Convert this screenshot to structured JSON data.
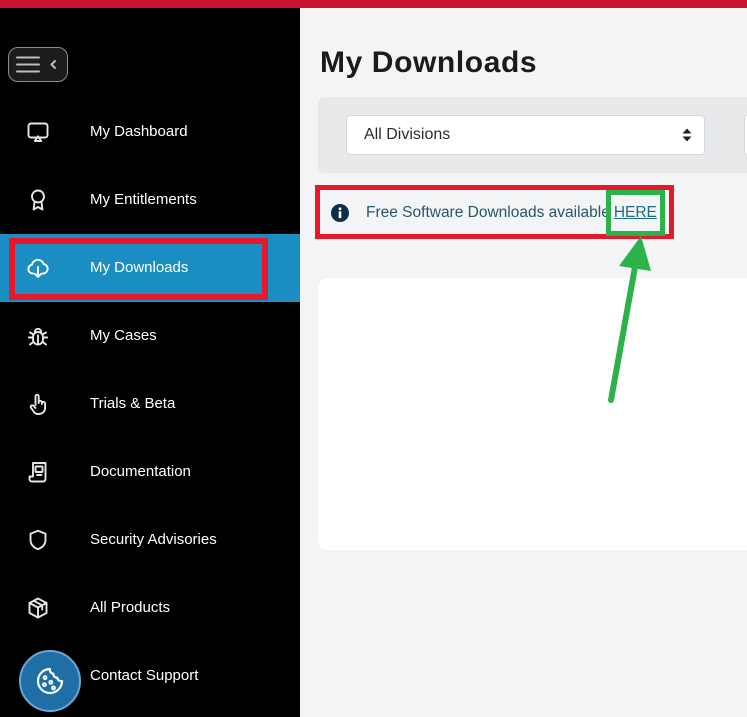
{
  "colors": {
    "top_bar": "#cc1431",
    "sidebar_bg": "#000000",
    "active_bg": "#1a8dc2",
    "page_bg": "#f3f4f5",
    "filter_bg": "#e7e9eb",
    "card_bg": "#ffffff",
    "title_text": "#1b1b1d",
    "sidebar_text": "#ffffff",
    "sidebar_icon": "#e6e6e6",
    "support_circle": "#1f6ea6",
    "info_icon": "#0f2e4c",
    "notice_text": "#265868",
    "link": "#1b6b88",
    "ann_red": "#e5182c",
    "ann_green": "#2cb24a"
  },
  "sidebar": {
    "toggle_icon": "menu-collapse-icon",
    "items": [
      {
        "label": "My Dashboard",
        "icon": "dashboard-icon",
        "active": false
      },
      {
        "label": "My Entitlements",
        "icon": "award-icon",
        "active": false
      },
      {
        "label": "My Downloads",
        "icon": "cloud-download-icon",
        "active": true
      },
      {
        "label": "My Cases",
        "icon": "bug-icon",
        "active": false
      },
      {
        "label": "Trials & Beta",
        "icon": "hand-pointer-icon",
        "active": false
      },
      {
        "label": "Documentation",
        "icon": "documentation-icon",
        "active": false
      },
      {
        "label": "Security Advisories",
        "icon": "shield-icon",
        "active": false
      },
      {
        "label": "All Products",
        "icon": "cube-icon",
        "active": false
      },
      {
        "label": "Contact Support",
        "icon": "cookie-icon",
        "active": false
      }
    ]
  },
  "main": {
    "title": "My Downloads",
    "filters": {
      "division": {
        "selected": "All Divisions",
        "icon": "sort-arrows-icon"
      }
    },
    "notice": {
      "icon": "info-icon",
      "text": "Free Software Downloads available",
      "link_text": "HERE"
    }
  }
}
